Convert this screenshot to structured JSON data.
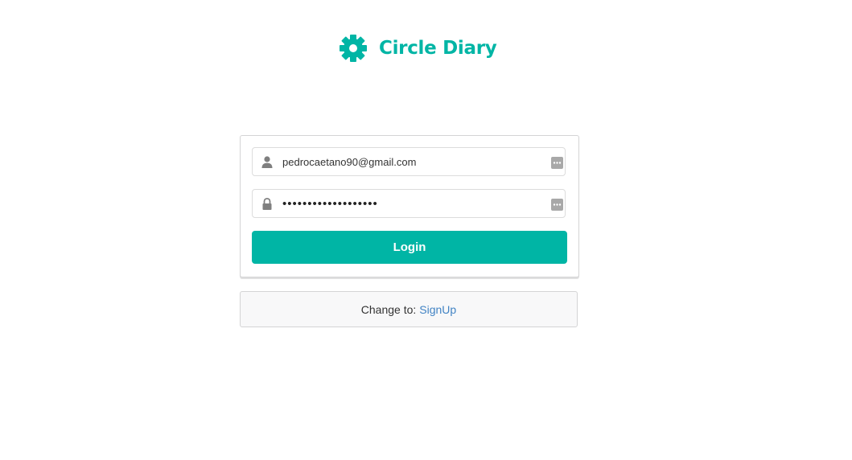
{
  "brand": {
    "title": "Circle Diary",
    "icon": "gear-icon",
    "color": "#00b5a5"
  },
  "login_form": {
    "email": {
      "value": "pedrocaetano90@gmail.com",
      "icon": "user-icon",
      "trailing_icon": "password-manager-icon"
    },
    "password": {
      "masked_value": "•••••••••••••••••••",
      "icon": "lock-icon",
      "trailing_icon": "password-manager-icon"
    },
    "login_label": "Login",
    "button_color": "#00b5a5"
  },
  "switch_message": {
    "prefix": "Change to:",
    "link_label": "SignUp",
    "link_color": "#4183c4"
  }
}
